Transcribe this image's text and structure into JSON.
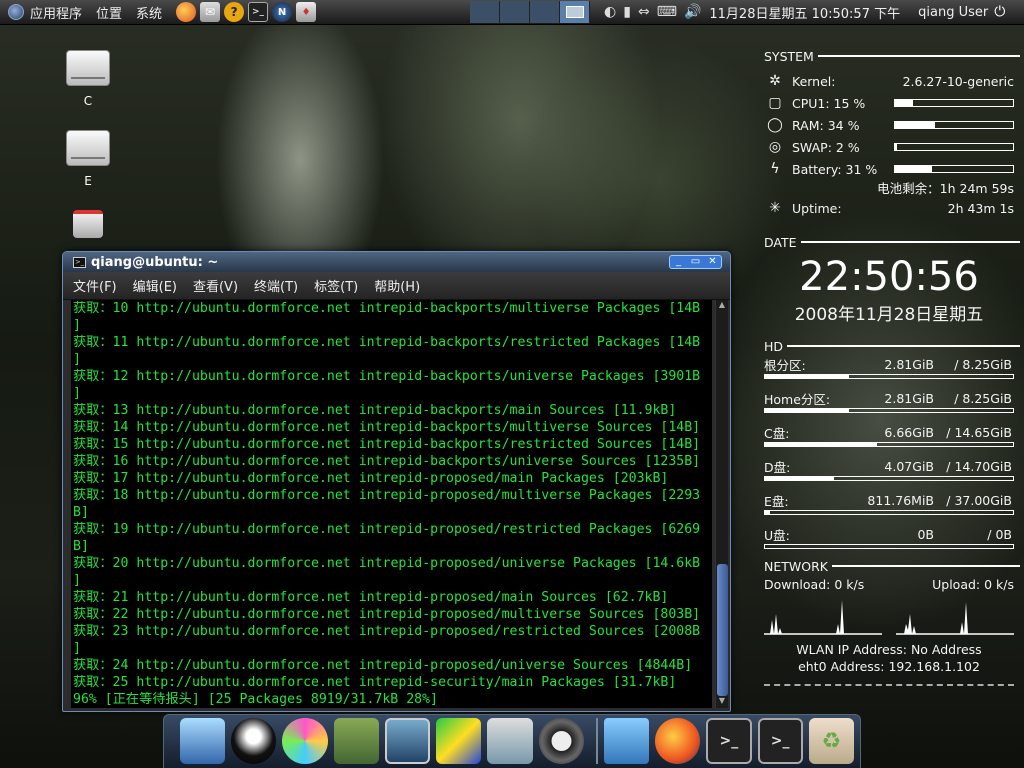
{
  "top_panel": {
    "menus": [
      "应用程序",
      "位置",
      "系统"
    ],
    "clock": "11月28日星期五 10:50:57 下午",
    "user": "qiang User"
  },
  "desktop_icons": [
    {
      "label": "C",
      "icon": "drive-icon"
    },
    {
      "label": "E",
      "icon": "drive-icon"
    },
    {
      "label": "",
      "icon": "remote-desktop-icon"
    }
  ],
  "terminal": {
    "title": "qiang@ubuntu: ~",
    "menus": [
      "文件(F)",
      "编辑(E)",
      "查看(V)",
      "终端(T)",
      "标签(T)",
      "帮助(H)"
    ],
    "lines": [
      "获取：10 http://ubuntu.dormforce.net intrepid-backports/multiverse Packages [14B",
      "]",
      "获取：11 http://ubuntu.dormforce.net intrepid-backports/restricted Packages [14B",
      "]",
      "获取：12 http://ubuntu.dormforce.net intrepid-backports/universe Packages [3901B",
      "]",
      "获取：13 http://ubuntu.dormforce.net intrepid-backports/main Sources [11.9kB]",
      "获取：14 http://ubuntu.dormforce.net intrepid-backports/multiverse Sources [14B]",
      "获取：15 http://ubuntu.dormforce.net intrepid-backports/restricted Sources [14B]",
      "获取：16 http://ubuntu.dormforce.net intrepid-backports/universe Sources [1235B]",
      "获取：17 http://ubuntu.dormforce.net intrepid-proposed/main Packages [203kB]",
      "获取：18 http://ubuntu.dormforce.net intrepid-proposed/multiverse Packages [2293",
      "B]",
      "获取：19 http://ubuntu.dormforce.net intrepid-proposed/restricted Packages [6269",
      "B]",
      "获取：20 http://ubuntu.dormforce.net intrepid-proposed/universe Packages [14.6kB",
      "]",
      "获取：21 http://ubuntu.dormforce.net intrepid-proposed/main Sources [62.7kB]",
      "获取：22 http://ubuntu.dormforce.net intrepid-proposed/multiverse Sources [803B]",
      "获取：23 http://ubuntu.dormforce.net intrepid-proposed/restricted Sources [2008B",
      "]",
      "获取：24 http://ubuntu.dormforce.net intrepid-proposed/universe Sources [4844B]",
      "获取：25 http://ubuntu.dormforce.net intrepid-security/main Packages [31.7kB]",
      "96% [正在等待报头] [25 Packages 8919/31.7kB 28%]"
    ]
  },
  "conky": {
    "system": {
      "heading": "SYSTEM",
      "kernel_label": "Kernel:",
      "kernel_value": "2.6.27-10-generic",
      "cpu_label": "CPU1: 15 %",
      "cpu_pct": 15,
      "ram_label": "RAM: 34 %",
      "ram_pct": 34,
      "swap_label": "SWAP: 2  %",
      "swap_pct": 2,
      "battery_label": "Battery: 31 %",
      "battery_pct": 31,
      "battery_remaining": "电池剩余：1h 24m 59s",
      "uptime_label": "Uptime:",
      "uptime_value": "2h 43m 1s"
    },
    "date": {
      "heading": "DATE",
      "time": "22:50:56",
      "date": "2008年11月28日星期五"
    },
    "hd": {
      "heading": "HD",
      "drives": [
        {
          "name": "根分区:",
          "used": "2.81GiB",
          "total": "/ 8.25GiB",
          "pct": 34
        },
        {
          "name": "Home分区:",
          "used": "2.81GiB",
          "total": "/ 8.25GiB",
          "pct": 34
        },
        {
          "name": "C盘:",
          "used": "6.66GiB",
          "total": "/ 14.65GiB",
          "pct": 45
        },
        {
          "name": "D盘:",
          "used": "4.07GiB",
          "total": "/ 14.70GiB",
          "pct": 28
        },
        {
          "name": "E盘:",
          "used": "811.76MiB",
          "total": "/ 37.00GiB",
          "pct": 2
        },
        {
          "name": "U盘:",
          "used": "0B",
          "total": "/ 0B",
          "pct": 0
        }
      ]
    },
    "network": {
      "heading": "NETWORK",
      "download": "Download: 0    k/s",
      "upload": "Upload: 0    k/s",
      "wlan": "WLAN IP Address: No Address",
      "eth": "eht0 Address: 192.168.1.102"
    }
  },
  "dock": {
    "items": [
      "screensaver-icon",
      "qq-icon",
      "pinwheel-icon",
      "books-icon",
      "system-monitor-icon",
      "inkscape-icon",
      "tools-icon",
      "audio-player-icon",
      "folder-icon",
      "firefox-icon",
      "terminal-icon",
      "terminal-icon",
      "trash-icon"
    ]
  }
}
